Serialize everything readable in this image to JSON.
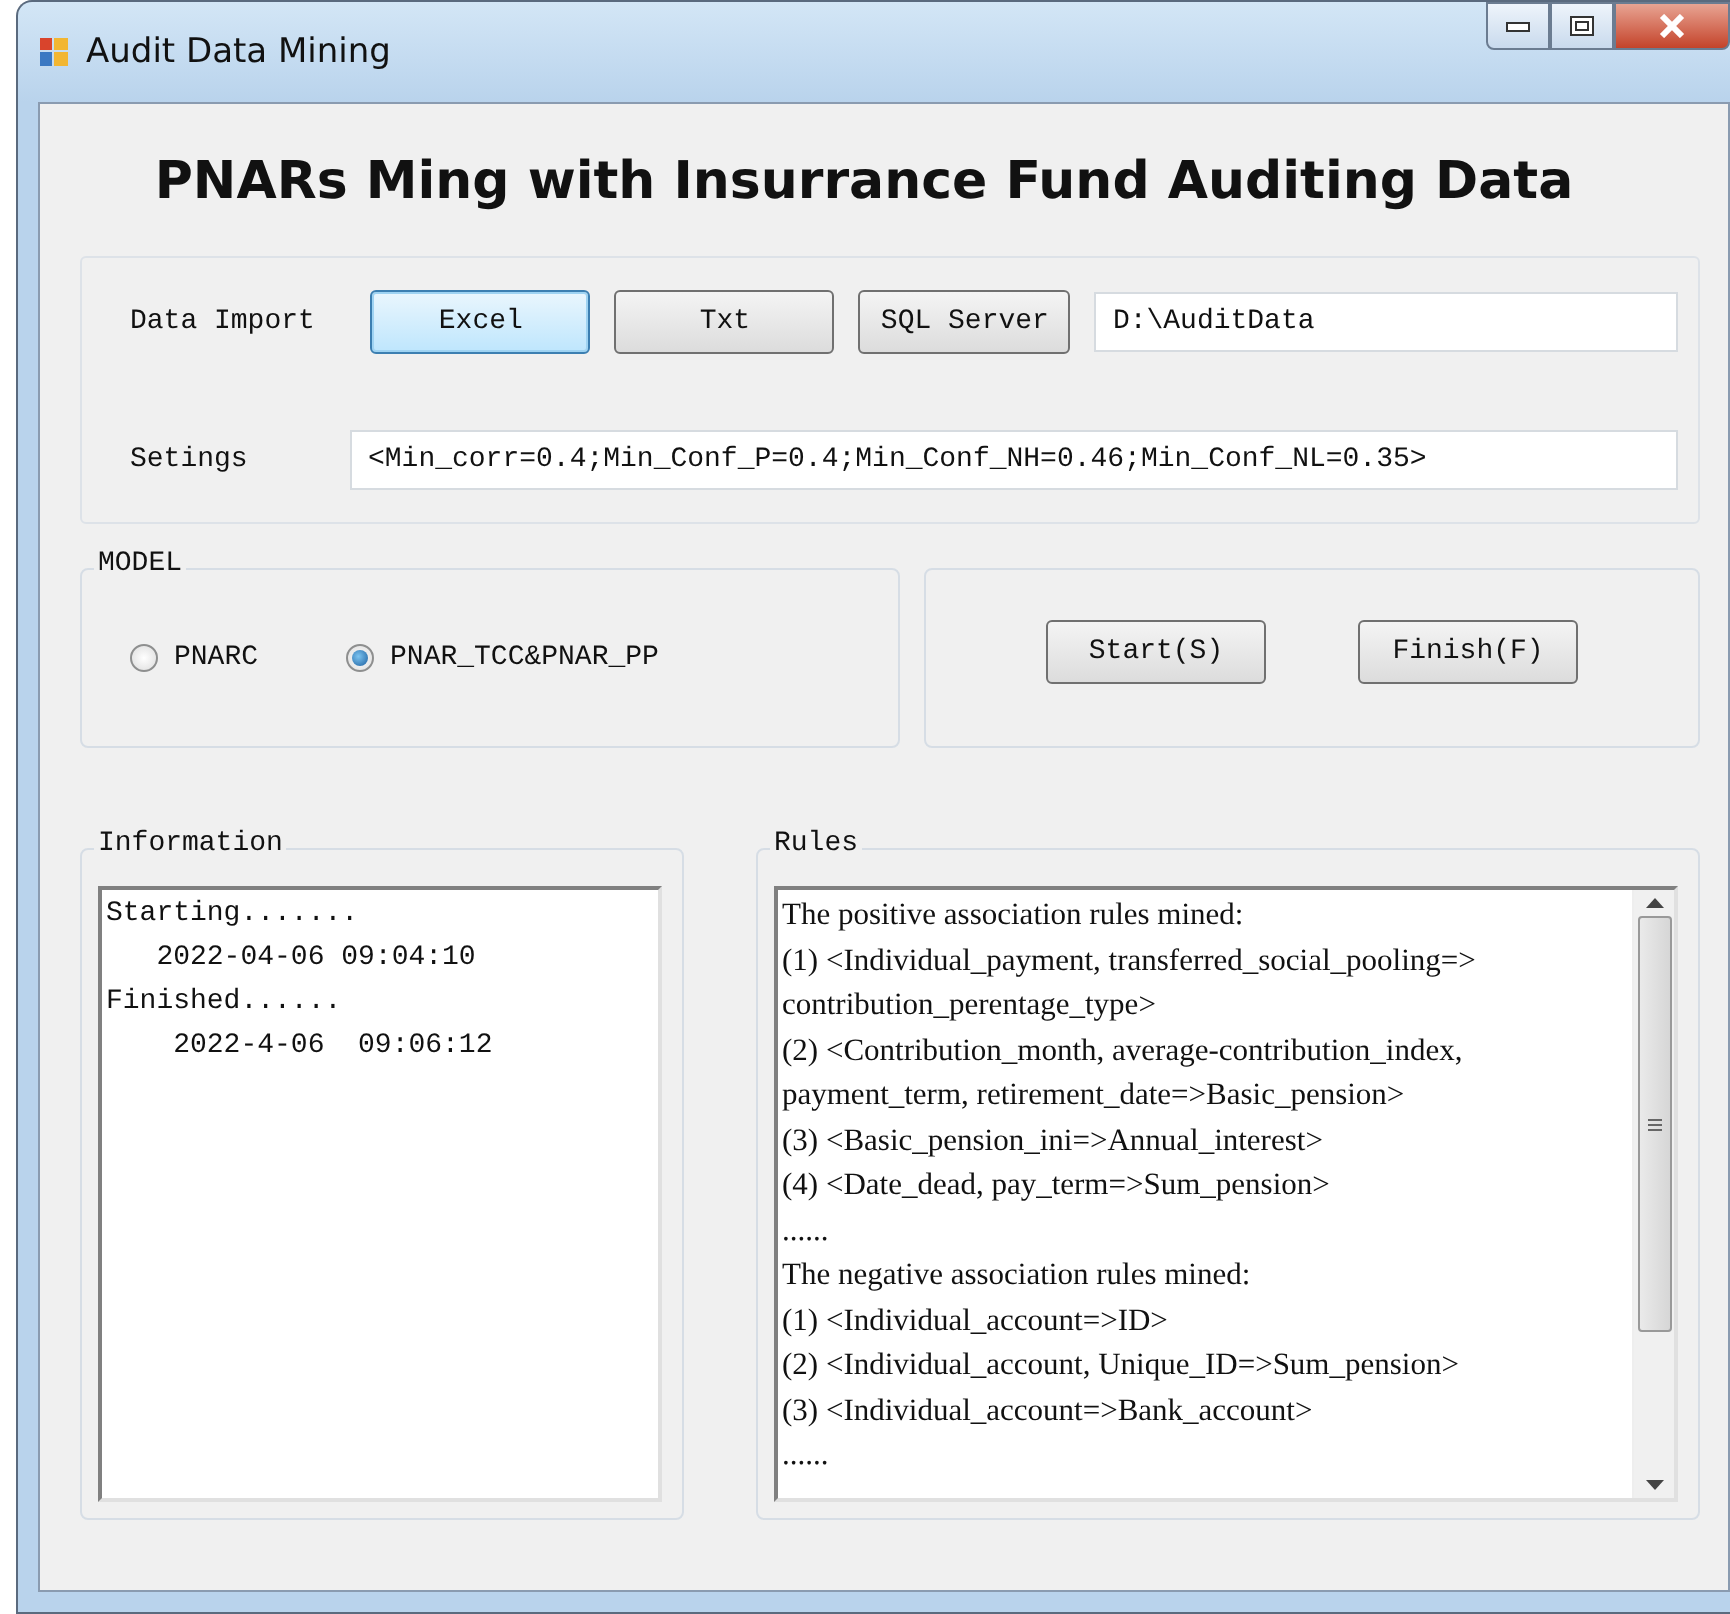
{
  "window": {
    "title": "Audit Data Mining"
  },
  "heading": "PNARs Ming with Insurrance Fund Auditing Data",
  "import": {
    "label": "Data Import",
    "buttons": [
      {
        "label": "Excel",
        "focused": true
      },
      {
        "label": "Txt",
        "focused": false
      },
      {
        "label": "SQL Server",
        "focused": false
      }
    ],
    "path": "D:\\AuditData"
  },
  "settings": {
    "label": "Setings",
    "value": "<Min_corr=0.4;Min_Conf_P=0.4;Min_Conf_NH=0.46;Min_Conf_NL=0.35>"
  },
  "model": {
    "title": "MODEL",
    "options": [
      {
        "label": "PNARC",
        "selected": false
      },
      {
        "label": "PNAR_TCC&PNAR_PP",
        "selected": true
      }
    ]
  },
  "actions": [
    "Start(S)",
    "Finish(F)"
  ],
  "information": {
    "title": "Information",
    "lines": [
      "Starting.......",
      "   2022-04-06 09:04:10",
      "Finished......",
      "    2022-4-06  09:06:12"
    ]
  },
  "rules": {
    "title": "Rules",
    "lines": [
      "The positive association rules mined:",
      "(1) <Individual_payment, transferred_social_pooling=>",
      "contribution_perentage_type>",
      "(2) <Contribution_month, average-contribution_index,",
      "payment_term, retirement_date=>Basic_pension>",
      "(3) <Basic_pension_ini=>Annual_interest>",
      "(4) <Date_dead, pay_term=>Sum_pension>",
      "......",
      "The negative association rules mined:",
      "(1) <Individual_account=>ID>",
      "(2) <Individual_account, Unique_ID=>Sum_pension>",
      "(3) <Individual_account=>Bank_account>",
      "......"
    ]
  }
}
